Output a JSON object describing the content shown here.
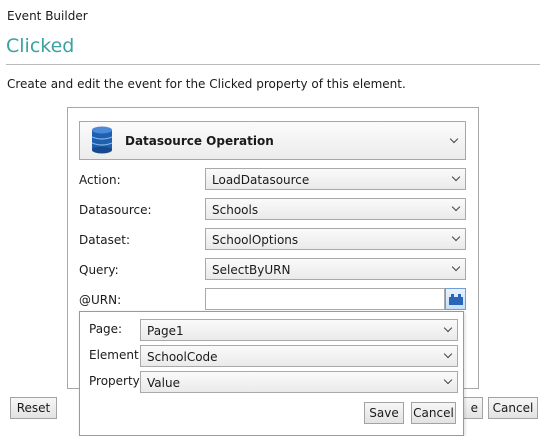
{
  "header": {
    "app_title": "Event Builder",
    "event_name": "Clicked",
    "description": "Create and edit the event for the Clicked property of this element."
  },
  "operation": {
    "icon": "database-icon",
    "label": "Datasource Operation"
  },
  "fields": [
    {
      "label": "Action:",
      "value": "LoadDatasource"
    },
    {
      "label": "Datasource:",
      "value": "Schools"
    },
    {
      "label": "Dataset:",
      "value": "SchoolOptions"
    },
    {
      "label": "Query:",
      "value": "SelectByURN"
    }
  ],
  "urn_param": {
    "label": "@URN:",
    "value": "",
    "picker_icon": "binding-picker-icon"
  },
  "binding_popup": {
    "page_label": "Page:",
    "page_value": "Page1",
    "element_label": "Element:",
    "element_value": "SchoolCode",
    "property_label": "Property:",
    "property_value": "Value",
    "save_label": "Save",
    "cancel_label": "Cancel"
  },
  "footer": {
    "reset_label": "Reset",
    "ok_label_visible": "e",
    "cancel_label": "Cancel"
  },
  "colors": {
    "accent_teal": "#3aa3a0",
    "db_icon_blue": "#1f5fb0",
    "picker_blue": "#2a66b8"
  }
}
